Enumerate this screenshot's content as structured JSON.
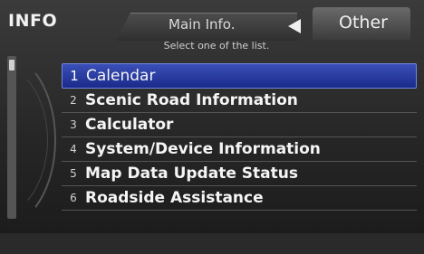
{
  "header": {
    "title": "INFO"
  },
  "tabs": {
    "main_label": "Main Info.",
    "other_label": "Other"
  },
  "subtitle": "Select one of the list.",
  "menu": {
    "items": [
      {
        "num": "1",
        "label": "Calendar",
        "selected": true
      },
      {
        "num": "2",
        "label": "Scenic Road Information"
      },
      {
        "num": "3",
        "label": "Calculator"
      },
      {
        "num": "4",
        "label": "System/Device Information"
      },
      {
        "num": "5",
        "label": "Map Data Update Status"
      },
      {
        "num": "6",
        "label": "Roadside Assistance"
      }
    ]
  },
  "colors": {
    "selected_bg": "#2a3ca8",
    "background": "#2e2e2e",
    "text": "#f5f5f5"
  }
}
